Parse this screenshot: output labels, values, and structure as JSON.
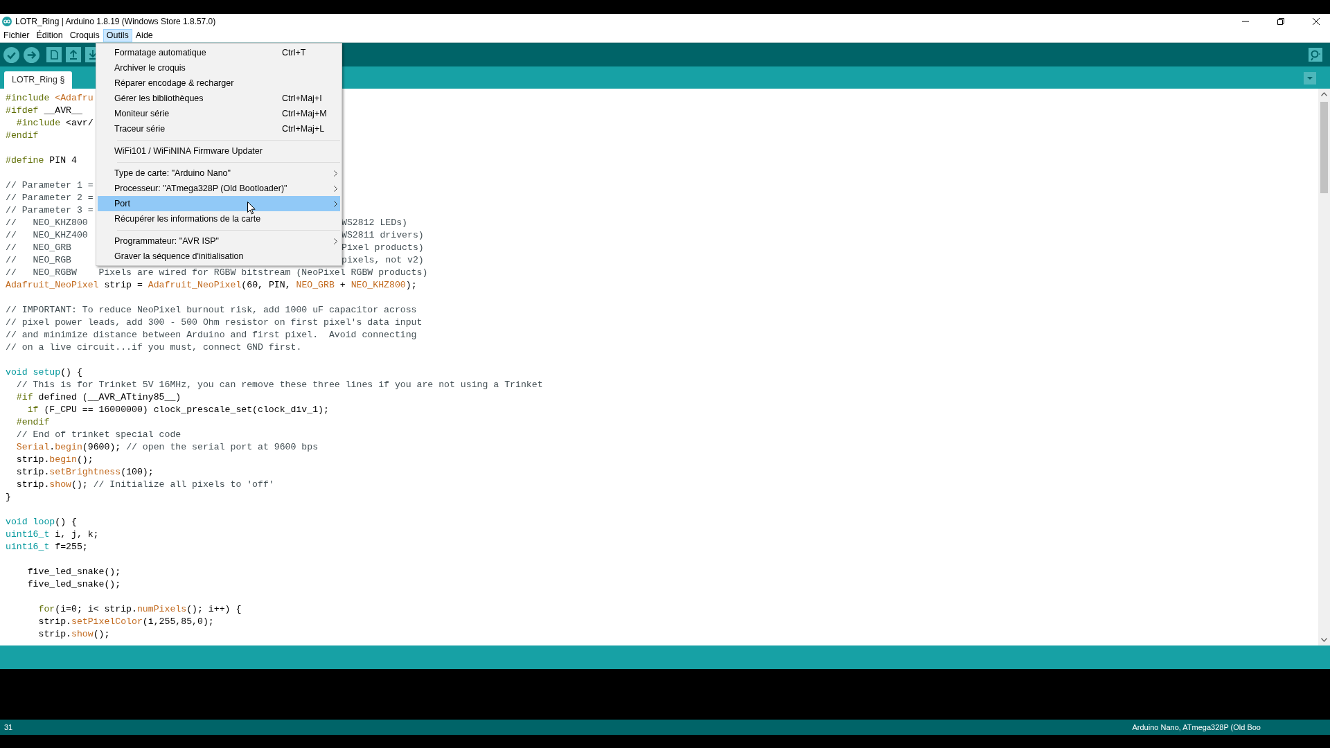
{
  "window": {
    "title": "LOTR_Ring | Arduino 1.8.19 (Windows Store 1.8.57.0)"
  },
  "menu_bar": [
    {
      "label": "Fichier",
      "selected": false
    },
    {
      "label": "Édition",
      "selected": false
    },
    {
      "label": "Croquis",
      "selected": false
    },
    {
      "label": "Outils",
      "selected": true
    },
    {
      "label": "Aide",
      "selected": false
    }
  ],
  "tabs": [
    {
      "label": "LOTR_Ring §",
      "selected": true
    }
  ],
  "menu": [
    {
      "kind": "item",
      "label": "Formatage automatique",
      "shortcut": "Ctrl+T",
      "submenu": false,
      "selected": false
    },
    {
      "kind": "item",
      "label": "Archiver le croquis",
      "submenu": false,
      "selected": false
    },
    {
      "kind": "item",
      "label": "Réparer encodage & recharger",
      "submenu": false,
      "selected": false
    },
    {
      "kind": "item",
      "label": "Gérer les bibliothèques",
      "shortcut": "Ctrl+Maj+I",
      "submenu": false,
      "selected": false
    },
    {
      "kind": "item",
      "label": "Moniteur série",
      "shortcut": "Ctrl+Maj+M",
      "submenu": false,
      "selected": false
    },
    {
      "kind": "item",
      "label": "Traceur série",
      "shortcut": "Ctrl+Maj+L",
      "submenu": false,
      "selected": false
    },
    {
      "kind": "separator"
    },
    {
      "kind": "item",
      "label": "WiFi101 / WiFiNINA Firmware Updater",
      "submenu": false,
      "selected": false
    },
    {
      "kind": "separator"
    },
    {
      "kind": "item",
      "label": "Type de carte: \"Arduino Nano\"",
      "submenu": true,
      "selected": false
    },
    {
      "kind": "item",
      "label": "Processeur: \"ATmega328P (Old Bootloader)\"",
      "submenu": true,
      "selected": false
    },
    {
      "kind": "item",
      "label": "Port",
      "submenu": true,
      "selected": true
    },
    {
      "kind": "item",
      "label": "Récupérer les informations de la carte",
      "submenu": false,
      "selected": false
    },
    {
      "kind": "separator"
    },
    {
      "kind": "item",
      "label": "Programmateur: \"AVR ISP\"",
      "submenu": true,
      "selected": false
    },
    {
      "kind": "item",
      "label": "Graver la séquence d'initialisation",
      "submenu": false,
      "selected": false
    }
  ],
  "code_lines": [
    {
      "kind": "code",
      "parts": [
        {
          "kind": "pre",
          "text": "#include "
        },
        {
          "kind": "fn",
          "text": "<Adafru"
        }
      ]
    },
    {
      "kind": "code",
      "parts": [
        {
          "kind": "pre",
          "text": "#ifdef"
        },
        {
          "kind": "plain",
          "text": " __AVR__"
        }
      ]
    },
    {
      "kind": "code",
      "parts": [
        {
          "kind": "pre",
          "text": "  #include"
        },
        {
          "kind": "plain",
          "text": " <avr/"
        }
      ]
    },
    {
      "kind": "code",
      "parts": [
        {
          "kind": "pre",
          "text": "#endif"
        }
      ]
    },
    {
      "kind": "blank"
    },
    {
      "kind": "code",
      "parts": [
        {
          "kind": "pre",
          "text": "#define"
        },
        {
          "kind": "plain",
          "text": " PIN 4"
        }
      ]
    },
    {
      "kind": "blank"
    },
    {
      "kind": "code",
      "parts": [
        {
          "kind": "comment",
          "text": "// Parameter 1 ="
        }
      ]
    },
    {
      "kind": "code",
      "parts": [
        {
          "kind": "comment",
          "text": "// Parameter 2 ="
        }
      ]
    },
    {
      "kind": "code",
      "parts": [
        {
          "kind": "comment",
          "text": "// Parameter 3 ="
        }
      ]
    },
    {
      "kind": "code",
      "parts": [
        {
          "kind": "comment",
          "text": "//   NEO_KHZ800"
        }
      ],
      "tail": "WS2812 LEDs)"
    },
    {
      "kind": "code",
      "parts": [
        {
          "kind": "comment",
          "text": "//   NEO_KHZ400"
        }
      ],
      "tail": "WS2811 drivers)"
    },
    {
      "kind": "code",
      "parts": [
        {
          "kind": "comment",
          "text": "//   NEO_GRB"
        }
      ],
      "tail": "Pixel products)"
    },
    {
      "kind": "code",
      "parts": [
        {
          "kind": "comment",
          "text": "//   NEO_RGB"
        }
      ],
      "tail": "pixels, not v2)"
    },
    {
      "kind": "code",
      "parts": [
        {
          "kind": "comment",
          "text": "//   NEO_RGBW    Pixels are wired for RGBW bitstream (NeoPixel RGBW products)"
        }
      ]
    },
    {
      "kind": "code",
      "parts": [
        {
          "kind": "fn",
          "text": "Adafruit_NeoPixel"
        },
        {
          "kind": "plain",
          "text": " strip = "
        },
        {
          "kind": "fn",
          "text": "Adafruit_NeoPixel"
        },
        {
          "kind": "plain",
          "text": "(60, PIN, "
        },
        {
          "kind": "fn",
          "text": "NEO_GRB"
        },
        {
          "kind": "plain",
          "text": " + "
        },
        {
          "kind": "fn",
          "text": "NEO_KHZ800"
        },
        {
          "kind": "plain",
          "text": ");"
        }
      ]
    },
    {
      "kind": "blank"
    },
    {
      "kind": "code",
      "parts": [
        {
          "kind": "comment",
          "text": "// IMPORTANT: To reduce NeoPixel burnout risk, add 1000 uF capacitor across"
        }
      ]
    },
    {
      "kind": "code",
      "parts": [
        {
          "kind": "comment",
          "text": "// pixel power leads, add 300 - 500 Ohm resistor on first pixel's data input"
        }
      ]
    },
    {
      "kind": "code",
      "parts": [
        {
          "kind": "comment",
          "text": "// and minimize distance between Arduino and first pixel.  Avoid connecting"
        }
      ]
    },
    {
      "kind": "code",
      "parts": [
        {
          "kind": "comment",
          "text": "// on a live circuit...if you must, connect GND first."
        }
      ]
    },
    {
      "kind": "blank"
    },
    {
      "kind": "code",
      "parts": [
        {
          "kind": "type",
          "text": "void setup"
        },
        {
          "kind": "plain",
          "text": "() {"
        }
      ]
    },
    {
      "kind": "code",
      "parts": [
        {
          "kind": "comment",
          "text": "  // This is for Trinket 5V 16MHz, you can remove these three lines if you are not using a Trinket"
        }
      ]
    },
    {
      "kind": "code",
      "parts": [
        {
          "kind": "pre",
          "text": "  #if"
        },
        {
          "kind": "plain",
          "text": " defined (__AVR_ATtiny85__)"
        }
      ]
    },
    {
      "kind": "code",
      "parts": [
        {
          "kind": "pre",
          "text": "    if"
        },
        {
          "kind": "plain",
          "text": " (F_CPU == 16000000) clock_prescale_set(clock_div_1);"
        }
      ]
    },
    {
      "kind": "code",
      "parts": [
        {
          "kind": "pre",
          "text": "  #endif"
        }
      ]
    },
    {
      "kind": "code",
      "parts": [
        {
          "kind": "comment",
          "text": "  // End of trinket special code"
        }
      ]
    },
    {
      "kind": "code",
      "parts": [
        {
          "kind": "fn",
          "text": "  Serial"
        },
        {
          "kind": "plain",
          "text": "."
        },
        {
          "kind": "fn",
          "text": "begin"
        },
        {
          "kind": "plain",
          "text": "(9600); "
        },
        {
          "kind": "comment",
          "text": "// open the serial port at 9600 bps"
        }
      ]
    },
    {
      "kind": "code",
      "parts": [
        {
          "kind": "plain",
          "text": "  strip."
        },
        {
          "kind": "fn",
          "text": "begin"
        },
        {
          "kind": "plain",
          "text": "();"
        }
      ]
    },
    {
      "kind": "code",
      "parts": [
        {
          "kind": "plain",
          "text": "  strip."
        },
        {
          "kind": "fn",
          "text": "setBrightness"
        },
        {
          "kind": "plain",
          "text": "(100);"
        }
      ]
    },
    {
      "kind": "code",
      "parts": [
        {
          "kind": "plain",
          "text": "  strip."
        },
        {
          "kind": "fn",
          "text": "show"
        },
        {
          "kind": "plain",
          "text": "(); "
        },
        {
          "kind": "comment",
          "text": "// Initialize all pixels to 'off'"
        }
      ]
    },
    {
      "kind": "code",
      "parts": [
        {
          "kind": "plain",
          "text": "}"
        }
      ]
    },
    {
      "kind": "blank"
    },
    {
      "kind": "code",
      "parts": [
        {
          "kind": "type",
          "text": "void loop"
        },
        {
          "kind": "plain",
          "text": "() {"
        }
      ]
    },
    {
      "kind": "code",
      "parts": [
        {
          "kind": "type",
          "text": "uint16_t"
        },
        {
          "kind": "plain",
          "text": " i, j, k;"
        }
      ]
    },
    {
      "kind": "code",
      "parts": [
        {
          "kind": "type",
          "text": "uint16_t"
        },
        {
          "kind": "plain",
          "text": " f=255;"
        }
      ]
    },
    {
      "kind": "blank"
    },
    {
      "kind": "code",
      "parts": [
        {
          "kind": "plain",
          "text": "    five_led_snake();"
        }
      ]
    },
    {
      "kind": "code",
      "parts": [
        {
          "kind": "plain",
          "text": "    five_led_snake();"
        }
      ]
    },
    {
      "kind": "blank"
    },
    {
      "kind": "code",
      "parts": [
        {
          "kind": "pre",
          "text": "      for"
        },
        {
          "kind": "plain",
          "text": "(i=0; i< strip."
        },
        {
          "kind": "fn",
          "text": "numPixels"
        },
        {
          "kind": "plain",
          "text": "(); i++) {"
        }
      ]
    },
    {
      "kind": "code",
      "parts": [
        {
          "kind": "plain",
          "text": "      strip."
        },
        {
          "kind": "fn",
          "text": "setPixelColor"
        },
        {
          "kind": "plain",
          "text": "(i,255,85,0);"
        }
      ]
    },
    {
      "kind": "code",
      "parts": [
        {
          "kind": "plain",
          "text": "      strip."
        },
        {
          "kind": "fn",
          "text": "show"
        },
        {
          "kind": "plain",
          "text": "();"
        }
      ]
    }
  ],
  "status_bar": {
    "line": "31",
    "board": "Arduino Nano, ATmega328P (Old Boo"
  }
}
